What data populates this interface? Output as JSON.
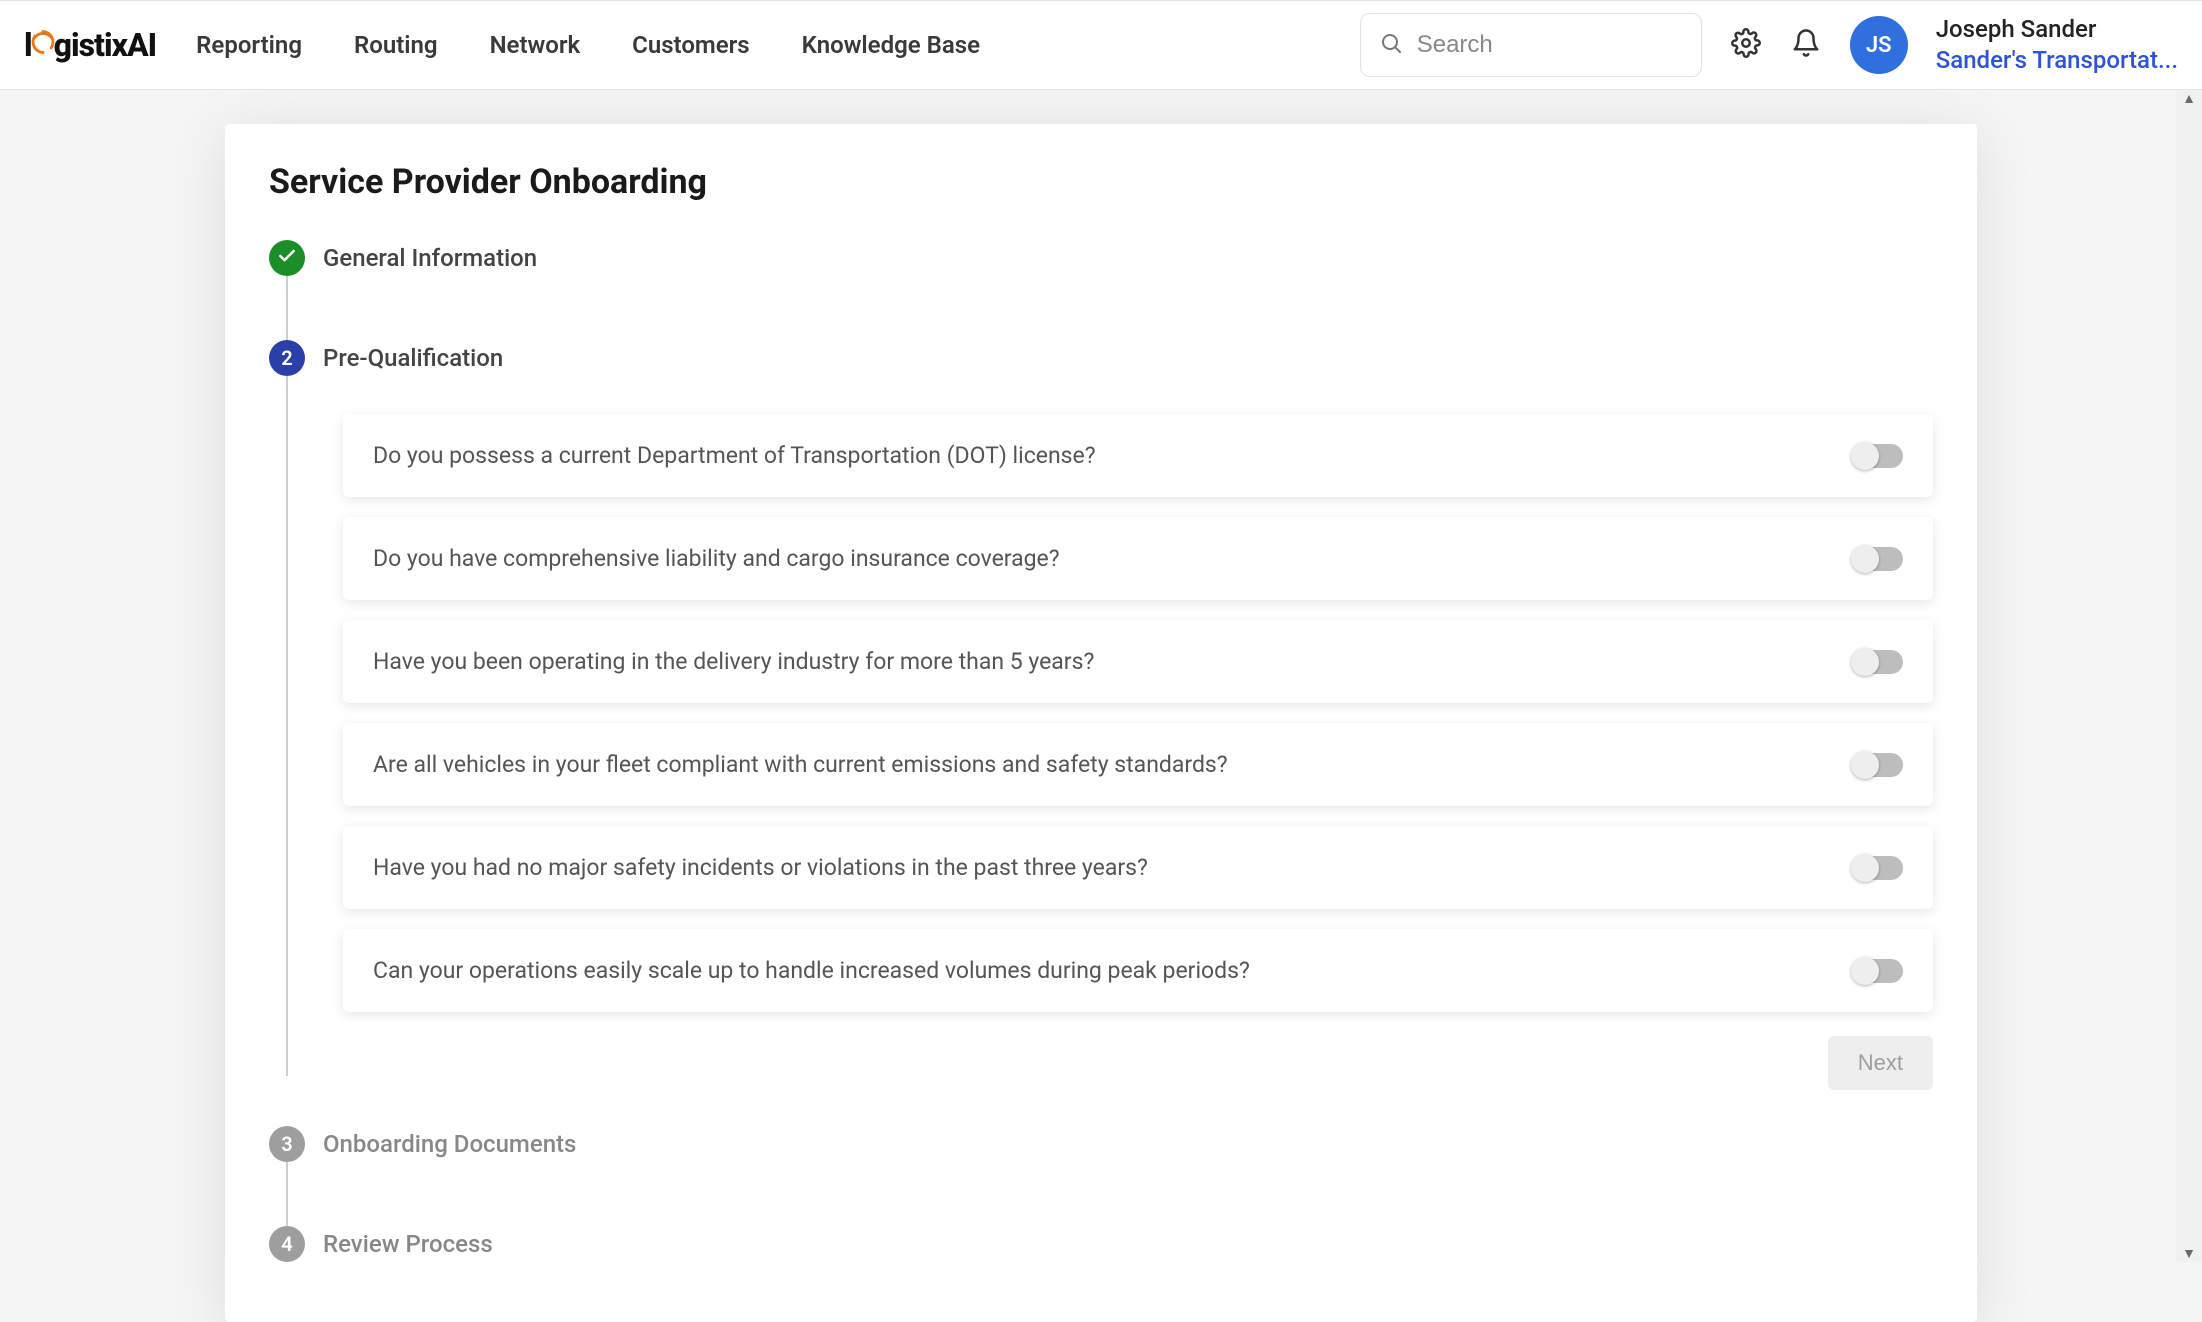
{
  "brand": {
    "pre": "l",
    "post": "gistixAI"
  },
  "nav": {
    "items": [
      "Reporting",
      "Routing",
      "Network",
      "Customers",
      "Knowledge Base"
    ]
  },
  "search": {
    "placeholder": "Search"
  },
  "user": {
    "initials": "JS",
    "name": "Joseph Sander",
    "company": "Sander's Transportat..."
  },
  "page": {
    "title": "Service Provider Onboarding"
  },
  "steps": {
    "s1": {
      "label": "General Information"
    },
    "s2": {
      "num": "2",
      "label": "Pre-Qualification"
    },
    "s3": {
      "num": "3",
      "label": "Onboarding Documents"
    },
    "s4": {
      "num": "4",
      "label": "Review Process"
    }
  },
  "questions": [
    "Do you possess a current Department of Transportation (DOT) license?",
    "Do you have comprehensive liability and cargo insurance coverage?",
    "Have you been operating in the delivery industry for more than 5 years?",
    "Are all vehicles in your fleet compliant with current emissions and safety standards?",
    "Have you had no major safety incidents or violations in the past three years?",
    "Can your operations easily scale up to handle increased volumes during peak periods?"
  ],
  "buttons": {
    "next": "Next"
  }
}
